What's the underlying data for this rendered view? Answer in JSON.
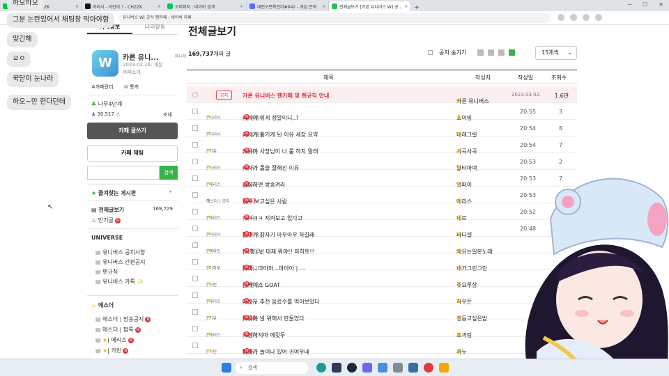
{
  "browser": {
    "tabs": [
      {
        "label": "아리사 채널 - CHZZK",
        "color": "#00c73c",
        "active": false
      },
      {
        "label": "아리사 - 어린이 ? - CHZZK",
        "color": "#111111",
        "active": false
      },
      {
        "label": "오피지지 : 네이버 검색",
        "color": "#03c75a",
        "active": false
      },
      {
        "label": "대전오면옥인더#042 - 게임 전적",
        "color": "#5b6cf0",
        "active": false
      },
      {
        "label": "전체글보기 [카른 유니버스 W] 공...",
        "color": "#2ac150",
        "active": true
      }
    ],
    "url": "유니버스 W| 공식 팬카페 : 네이버 카페"
  },
  "chat_bubbles": [
    "하오하오",
    "그분 논란있어서 채팅창 막아야함",
    "맞긴해",
    "ㄹㅇ",
    "꾹닫이 눈나라",
    "하오~만 한다던데"
  ],
  "cafe": {
    "tabs": [
      "카페정보",
      "나의활동"
    ],
    "name": "카른 유니...",
    "manager": "매니저",
    "created": "2023.02.16. 개설",
    "intro": "카페소개",
    "manage_link": "카페관리",
    "stats_link": "통계",
    "level": "나무4단계",
    "members": "30,517",
    "invite": "초대",
    "write_btn": "카페 글쓰기",
    "chat_btn": "카페 채팅",
    "search_btn": "검색",
    "fav_boards": "즐겨찾는 게시판",
    "all_posts": "전체글보기",
    "all_count": "169,729",
    "popular": "인기글",
    "universe_header": "UNIVERSE",
    "universe_items": [
      "유니버스 공지사항",
      "유니버스 간편공지",
      "팬규칙",
      "유니버스 카톡 ✨"
    ],
    "esther_header": "에스더",
    "esther_items": [
      "에스더 | 방송공지",
      "에스더 | 팝톡",
      "| 에리스",
      "| 카린"
    ]
  },
  "main": {
    "title": "전체글보기",
    "count_num": "169,737",
    "count_suffix": "개의 글",
    "hide_notice": "공지 숨기기",
    "per_page": "15개씩",
    "headers": {
      "title": "제목",
      "author": "작성자",
      "date": "작성일",
      "views": "조회수"
    },
    "notice": {
      "badge": "공지",
      "title": "카른 유니버스 팬카페 및 팬규칙 안내",
      "author": "카른 유니버스",
      "date": "2023.03.02.",
      "views": "1.6만"
    },
    "rows": [
      {
        "cat": "| 아리사",
        "tag": "[생방송]",
        "title": "리사야 이게 정말이니..?",
        "cmt": "",
        "author": "초이밍",
        "date": "20:55",
        "views": "3"
      },
      {
        "cat": "| 아리사",
        "tag": "[생방송]",
        "title": "리사가 홈기게 된 이유 세장 요약",
        "cmt": "",
        "author": "데레그릴",
        "date": "20:54",
        "views": "8"
      },
      {
        "cat": "| 키유",
        "tag": "[자유]",
        "title": "키유야 사장님이 너 룰 하지 말래",
        "cmt": "",
        "author": "사곡사곡",
        "date": "20:54",
        "views": "7"
      },
      {
        "cat": "| 아리사",
        "tag": "[자유]",
        "title": "리사가 롤을 잘해진 이유",
        "cmt": "",
        "author": "말티마여",
        "date": "20:53",
        "views": "2"
      },
      {
        "cat": "| 에리스",
        "tag": "[자유]",
        "title": "심심하면 방송켜라",
        "cmt": "",
        "author": "엉파이",
        "date": "20:53",
        "views": "7"
      },
      {
        "cat": "에스더 | 공지",
        "tag": "",
        "title": "릿두 보고싶은 사람",
        "cmt": "[24]",
        "author": "에리스",
        "date": "20:53",
        "views": "151"
      },
      {
        "cat": "| 에리스",
        "tag": "[자유]",
        "title": "ㅋㅋㅋㅋ 지켜보고 있다고",
        "cmt": "",
        "author": "네르",
        "date": "20:52",
        "views": "2"
      },
      {
        "cat": "| 아리사",
        "tag": "[생방송]",
        "title": "친구가 갑자기 아우아우 하길래",
        "cmt": "[4]",
        "author": "바디셀",
        "date": "20:48",
        "views": ""
      },
      {
        "cat": "| 팬아트",
        "tag": "[미하루]",
        "title": "(억형) 넌 대체 뭐야!! 마히토!!",
        "cmt": "",
        "author": "왜요는일본노래",
        "date": "",
        "views": ""
      },
      {
        "cat": "| 미하루",
        "tag": "[자유]",
        "title": "마아...마마마...마아아 | ...",
        "cmt": "[2]",
        "author": "내가그린그린",
        "date": "",
        "views": ""
      },
      {
        "cat": "| 카린",
        "tag": "[생방송]",
        "title": "론케이스 GOAT",
        "cmt": "",
        "author": "쥬요루상",
        "date": "",
        "views": ""
      },
      {
        "cat": "| 에리스",
        "tag": "[자유]",
        "title": "에릿두 추천 음료수를 먹어보았다",
        "cmt": "",
        "author": "하우든",
        "date": "",
        "views": ""
      },
      {
        "cat": "| 키유",
        "tag": "[자유]",
        "title": "키유야 널 위해서 만들었다",
        "cmt": "[11]",
        "author": "정듬고싶은밤",
        "date": "",
        "views": ""
      },
      {
        "cat": "| 에리스",
        "tag": "[자유]",
        "title": "걱정하지마 에릿두",
        "cmt": "",
        "author": "조과팅",
        "date": "",
        "views": ""
      },
      {
        "cat": "| 카린",
        "tag": "[자유]",
        "title": "아가가 놀이나 있어 귀여우네",
        "cmt": "[2]",
        "author": "까누",
        "date": "",
        "views": ""
      }
    ]
  },
  "taskbar": {
    "search": "검색"
  }
}
